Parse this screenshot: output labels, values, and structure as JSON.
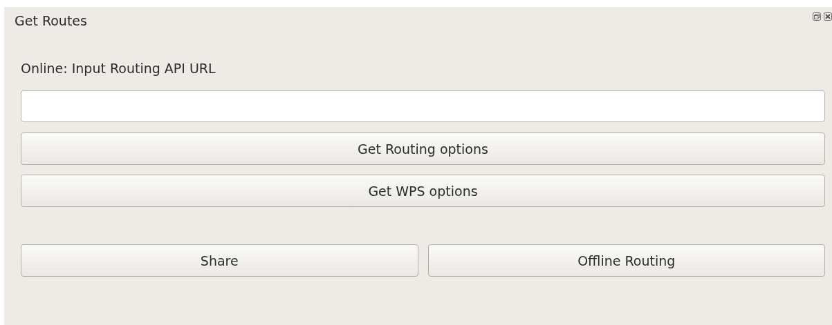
{
  "panel": {
    "title": "Get Routes"
  },
  "url_label": "Online: Input Routing API URL",
  "buttons": [
    "Get Routing options",
    "Get WPS options"
  ],
  "bottom_buttons": [
    "Share",
    "Offline Routing"
  ]
}
